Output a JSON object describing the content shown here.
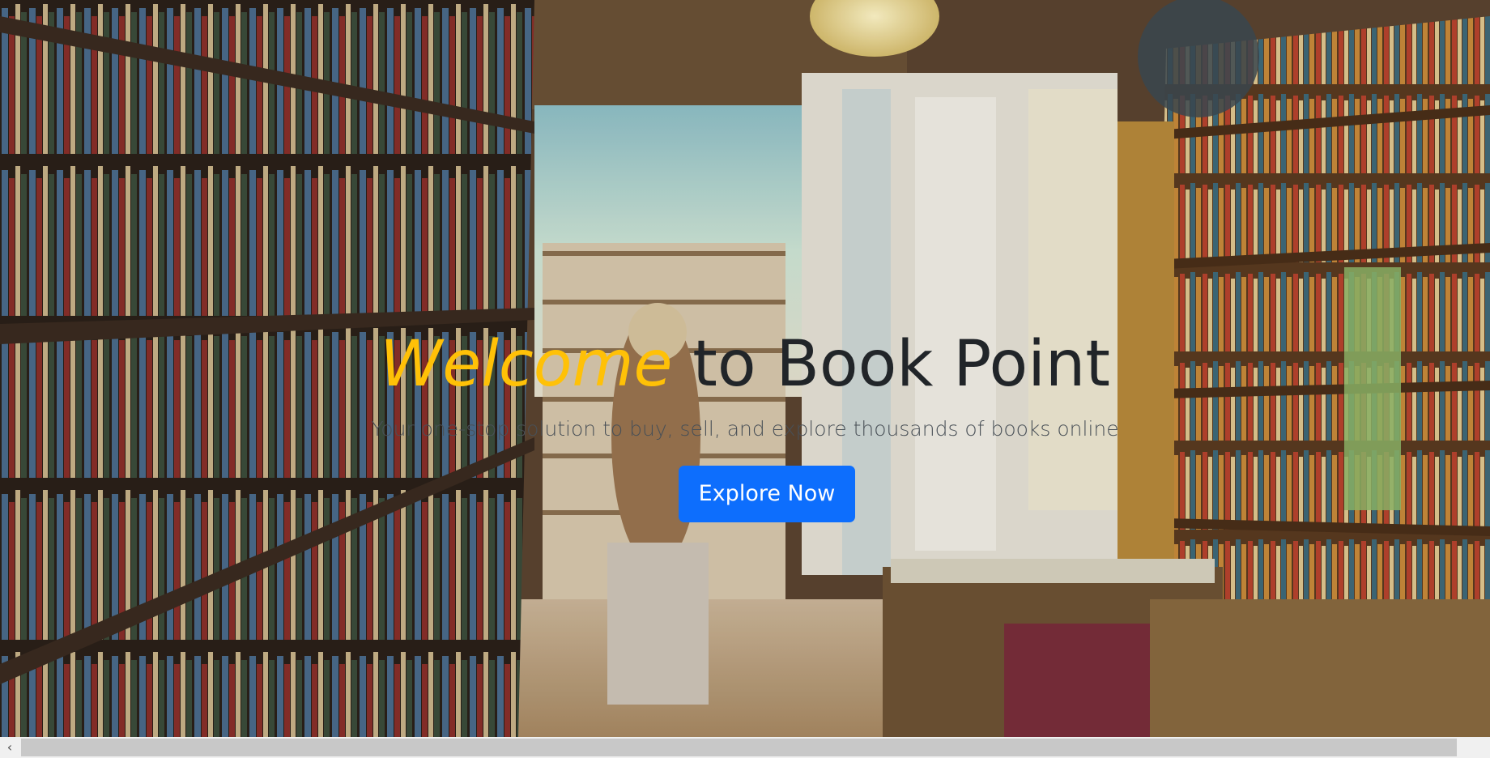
{
  "hero": {
    "headline_accent": "Welcome",
    "headline_rest": " to Book Point",
    "tagline": "Your one-stop solution to buy, sell, and explore thousands of books online",
    "cta_label": "Explore Now",
    "background": "bookstore-interior-photo"
  },
  "scrollbar": {
    "left_arrow": "‹"
  },
  "colors": {
    "accent": "#ffc107",
    "primary": "#0d6efd",
    "heading": "#212529",
    "tagline": "#495057"
  }
}
